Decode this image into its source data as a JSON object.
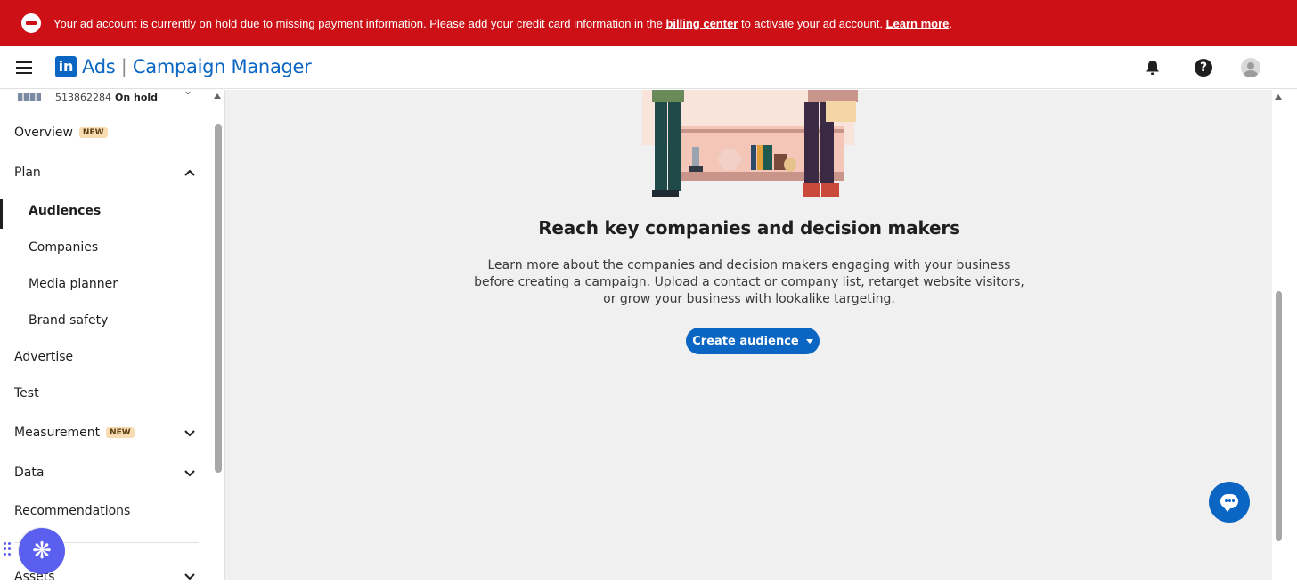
{
  "banner": {
    "message_before": "Your ad account is currently on hold due to missing payment information. Please add your credit card information in the ",
    "billing_link": "billing center",
    "message_middle": " to activate your ad account. ",
    "learn_more": "Learn more",
    "message_end": "."
  },
  "header": {
    "logo": "in",
    "title_ads": "Ads",
    "title_sep": " | ",
    "title_product": "Campaign Manager",
    "help_glyph": "?"
  },
  "sidebar": {
    "account_id": "513862284",
    "account_status": "On hold",
    "items": {
      "overview": "Overview",
      "overview_badge": "NEW",
      "plan": "Plan",
      "audiences": "Audiences",
      "companies": "Companies",
      "media_planner": "Media planner",
      "brand_safety": "Brand safety",
      "advertise": "Advertise",
      "test": "Test",
      "measurement": "Measurement",
      "measurement_badge": "NEW",
      "data": "Data",
      "recommendations": "Recommendations",
      "assets": "Assets"
    }
  },
  "main": {
    "headline": "Reach key companies and decision makers",
    "description": "Learn more about the companies and decision makers engaging with your business before creating a campaign. Upload a contact or company list, retarget website visitors, or grow your business with lookalike targeting.",
    "create_button": "Create audience"
  },
  "colors": {
    "banner_red": "#cc1016",
    "linkedin_blue": "#0a66c2",
    "assistant_purple": "#5b5fef",
    "badge_bg": "#f8dcb4"
  },
  "icons": [
    "stop-icon",
    "hamburger-icon",
    "linkedin-logo",
    "bell-icon",
    "help-icon",
    "avatar",
    "chevron-up-icon",
    "chevron-down-icon",
    "caret-down-icon",
    "chat-icon",
    "sparkle-icon",
    "drag-handle-icon"
  ]
}
